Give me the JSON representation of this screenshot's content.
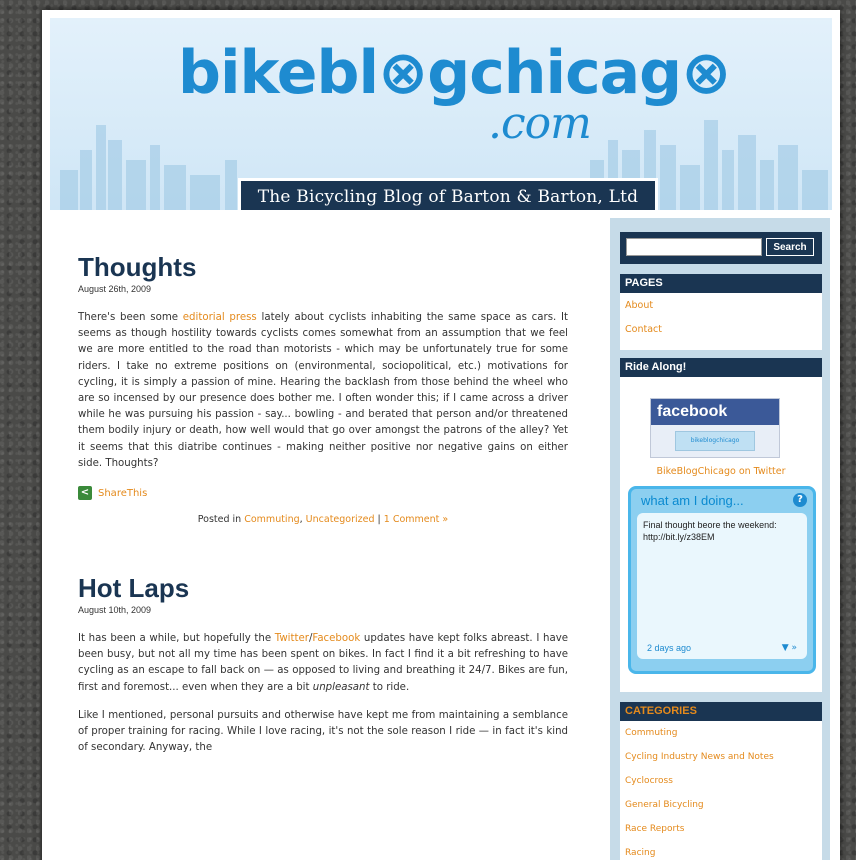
{
  "header": {
    "logo_main": "bikebl⊗gchicag⊗",
    "logo_com": ".com",
    "tagline": "The Bicycling Blog of Barton & Barton, Ltd"
  },
  "posts": [
    {
      "title": "Thoughts",
      "date": "August 26th, 2009",
      "body_pre": "There's been some ",
      "body_link": "editorial press",
      "body_post": " lately about cyclists inhabiting the same space as cars. It seems as though hostility towards cyclists comes somewhat from an assumption that we feel we are more entitled to the road than motorists - which may be unfortunately true for some riders. I take no extreme positions on (environmental, sociopolitical, etc.) motivations for cycling, it is simply a passion of mine. Hearing the backlash from those behind the wheel who are so incensed by our presence does bother me. I often wonder this; if I came across a driver while he was pursuing his passion - say... bowling - and berated that person and/or threatened them bodily injury or death, how well would that go over amongst the patrons of the alley? Yet it seems that this diatribe continues - making neither positive nor negative gains on either side. Thoughts?",
      "share_label": "ShareThis",
      "posted_in": "Posted in",
      "cat1": "Commuting",
      "cat2": "Uncategorized",
      "separator": "|",
      "comments": "1 Comment »"
    },
    {
      "title": "Hot Laps",
      "date": "August 10th, 2009",
      "p1_pre": "It has been a while, but hopefully the ",
      "p1_link1": "Twitter",
      "p1_slash": "/",
      "p1_link2": "Facebook",
      "p1_post": " updates have kept folks abreast. I have been busy, but not all my time has been spent on bikes. In fact I find it a bit refreshing to have cycling as an escape to fall back on — as opposed to living and breathing it 24/7. Bikes are fun, first and foremost... even when they are a bit ",
      "p1_em": "unpleasant",
      "p1_end": " to ride.",
      "p2": "Like I mentioned, personal pursuits and otherwise have kept me from maintaining a semblance of proper training for racing. While I love racing, it's not the sole reason I ride — in fact it's kind of secondary. Anyway, the"
    }
  ],
  "sidebar": {
    "search_button": "Search",
    "pages_heading": "PAGES",
    "pages": [
      "About",
      "Contact"
    ],
    "ride_heading": "Ride Along!",
    "facebook_label": "facebook",
    "facebook_badge": "bikeblogchicago",
    "twitter_link": "BikeBlogChicago on Twitter",
    "widget_title": "what am I doing...",
    "widget_help": "?",
    "widget_text": "Final thought beore the weekend: http://bit.ly/z38EM",
    "widget_time": "2 days ago",
    "widget_nav": "▼ »",
    "categories_heading": "CATEGORIES",
    "categories": [
      "Commuting",
      "Cycling Industry News and Notes",
      "Cyclocross",
      "General Bicycling",
      "Race Reports",
      "Racing"
    ]
  }
}
